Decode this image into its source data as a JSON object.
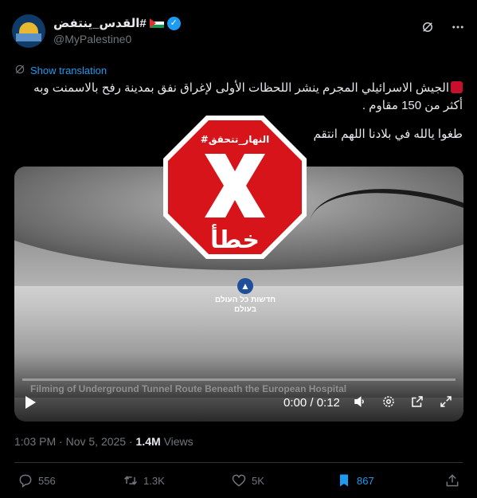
{
  "author": {
    "display_name": "القدس_ينتفض#",
    "handle": "@MyPalestine0"
  },
  "translation": {
    "label": "Show translation"
  },
  "tweet": {
    "line1": "الجيش الاسرائيلي المجرم ينشر اللحظات الأولى لإغراق نفق بمدينة رفح بالاسمنت وبه أكثر من 150 مقاوم .",
    "line2": "طغوا يالله في بلادنا اللهم انتقم"
  },
  "stamp": {
    "tag": "#النهار_تتحقق",
    "verdict": "خطأ",
    "color": "#d7141a"
  },
  "video": {
    "watermark": "חדשות כל העולם\nבעולם",
    "caption": "Filming of Underground Tunnel Route Beneath the European Hospital",
    "time": "0:00 / 0:12",
    "progress": 0
  },
  "meta": {
    "time": "1:03 PM",
    "date": "Nov 5, 2025",
    "views_count": "1.4M",
    "views_label": "Views"
  },
  "actions": {
    "replies": "556",
    "reposts": "1.3K",
    "likes": "5K",
    "bookmarks": "867"
  },
  "colors": {
    "accent": "#1d9bf0",
    "muted": "#71767b",
    "background": "#000000"
  }
}
